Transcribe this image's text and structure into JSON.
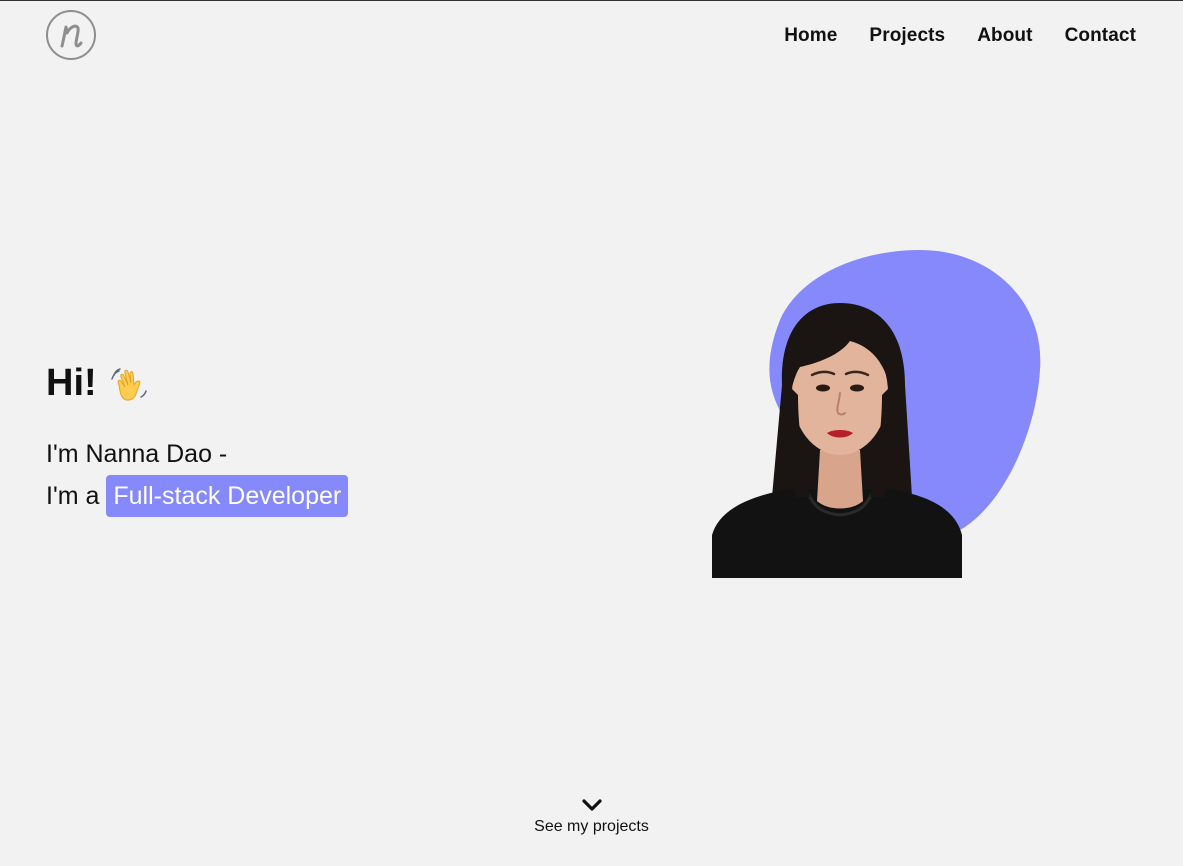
{
  "nav": {
    "items": [
      {
        "label": "Home"
      },
      {
        "label": "Projects"
      },
      {
        "label": "About"
      },
      {
        "label": "Contact"
      }
    ]
  },
  "hero": {
    "greeting": "Hi!",
    "intro_line1": "I'm Nanna Dao -",
    "intro_prefix": "I'm a",
    "role_highlight": "Full-stack Developer"
  },
  "cta": {
    "label": "See my projects"
  },
  "colors": {
    "background": "#f2f2f2",
    "accent": "#8589fb",
    "text": "#111111"
  },
  "icons": {
    "logo": "n-monogram-logo",
    "greeting": "waving-hand-icon",
    "cta": "chevron-down-icon"
  }
}
